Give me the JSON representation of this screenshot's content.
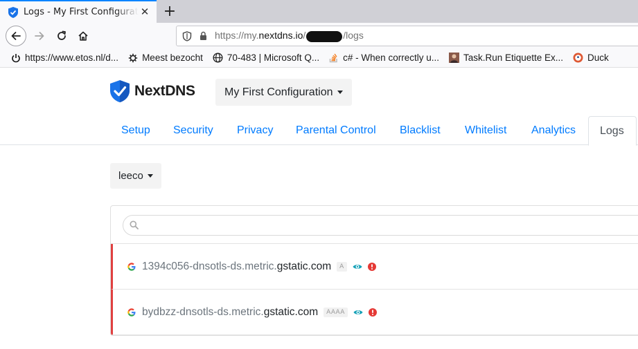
{
  "browser": {
    "tab_title": "Logs - My First Configuration",
    "tab_close": "✕",
    "new_tab": "+",
    "url_prefix": "https://my.",
    "url_host": "nextdns.io",
    "url_slash": "/",
    "url_path": "/logs"
  },
  "bookmarks": [
    {
      "label": "https://www.etos.nl/d...",
      "icon": "power-icon"
    },
    {
      "label": "Meest bezocht",
      "icon": "gear-icon"
    },
    {
      "label": "70-483 | Microsoft Q...",
      "icon": "globe-icon"
    },
    {
      "label": "c# - When correctly u...",
      "icon": "stackoverflow-icon"
    },
    {
      "label": "Task.Run Etiquette Ex...",
      "icon": "avatar-icon"
    },
    {
      "label": "Duck",
      "icon": "duckduckgo-icon"
    }
  ],
  "app": {
    "brand": "NextDNS",
    "config_selector": "My First Configuration",
    "device_selector": "leeco",
    "accent": "#007bff",
    "blocked_color": "#e04040"
  },
  "tabs": [
    {
      "label": "Setup"
    },
    {
      "label": "Security"
    },
    {
      "label": "Privacy"
    },
    {
      "label": "Parental Control"
    },
    {
      "label": "Blacklist"
    },
    {
      "label": "Whitelist"
    },
    {
      "label": "Analytics"
    },
    {
      "label": "Logs",
      "active": true
    }
  ],
  "search": {
    "placeholder": "",
    "value": ""
  },
  "logs": [
    {
      "subdomain": "1394c056-dnsotls-ds.metric.",
      "root": "gstatic.com",
      "type": "A",
      "favicon": "google-icon",
      "status": "blocked"
    },
    {
      "subdomain": "bydbzz-dnsotls-ds.metric.",
      "root": "gstatic.com",
      "type": "AAAA",
      "favicon": "google-icon",
      "status": "blocked"
    }
  ]
}
